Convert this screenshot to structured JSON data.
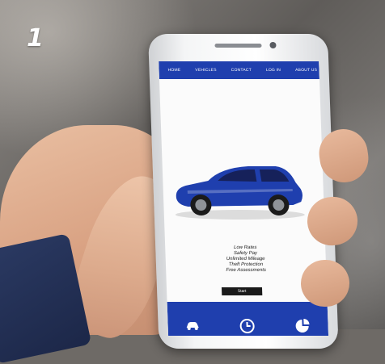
{
  "step_number": "1",
  "navigation": {
    "items": [
      {
        "label": "HOME"
      },
      {
        "label": "VEHICLES"
      },
      {
        "label": "CONTACT"
      },
      {
        "label": "LOG IN"
      },
      {
        "label": "ABOUT US"
      }
    ]
  },
  "hero": {
    "car_color": "#1f3fae",
    "features": [
      "Low Rates",
      "Safety Pay",
      "Unlimited Mileage",
      "Theft Protection",
      "Free Assessments"
    ],
    "start_label": "Start"
  },
  "footer": {
    "icons": [
      {
        "icon": "car-icon"
      },
      {
        "icon": "clock-icon"
      },
      {
        "icon": "pie-chart-icon"
      }
    ]
  },
  "colors": {
    "brand_blue": "#1f3fae",
    "button_dark": "#1a1a1a"
  }
}
